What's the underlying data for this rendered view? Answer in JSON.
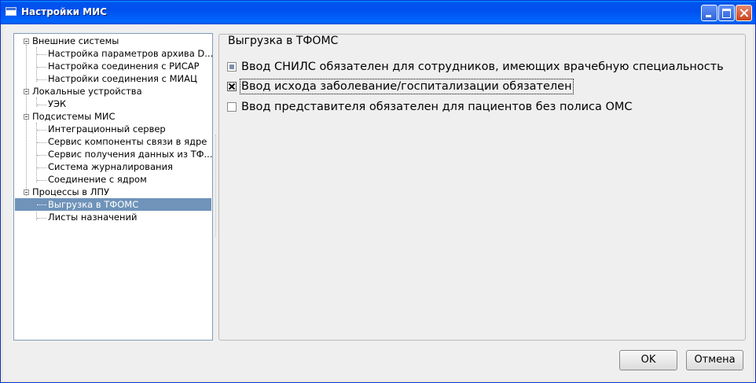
{
  "window": {
    "title": "Настройки МИС"
  },
  "tree": {
    "groups": [
      {
        "label": "Внешние системы",
        "children": [
          {
            "label": "Настройка параметров архива D..."
          },
          {
            "label": "Настройка соединения с РИСАР"
          },
          {
            "label": "Настройки соединения с МИАЦ"
          }
        ]
      },
      {
        "label": "Локальные устройства",
        "children": [
          {
            "label": "УЭК"
          }
        ]
      },
      {
        "label": "Подсистемы МИС",
        "children": [
          {
            "label": "Интеграционный сервер"
          },
          {
            "label": "Сервис компоненты связи в ядре"
          },
          {
            "label": "Сервис получения данных из ТФ..."
          },
          {
            "label": "Система журналирования"
          },
          {
            "label": "Соединение с ядром"
          }
        ]
      },
      {
        "label": "Процессы в ЛПУ",
        "children": [
          {
            "label": "Выгрузка в ТФОМС",
            "selected": true
          },
          {
            "label": "Листы назначений"
          }
        ]
      }
    ]
  },
  "panel": {
    "title": "Выгрузка в ТФОМС",
    "options": [
      {
        "label": "Ввод СНИЛС обязателен для сотрудников, имеющих врачебную специальность",
        "state": "partial"
      },
      {
        "label": "Ввод исхода заболевание/госпитализации обязателен",
        "state": "checked",
        "focused": true
      },
      {
        "label": "Ввод представителя обязателен для пациентов без полиса ОМС",
        "state": "unchecked"
      }
    ]
  },
  "buttons": {
    "ok": "OK",
    "cancel": "Отмена"
  },
  "colors": {
    "titlebar": "#0054e3",
    "selection": "#6f93b9",
    "background": "#efefef"
  }
}
